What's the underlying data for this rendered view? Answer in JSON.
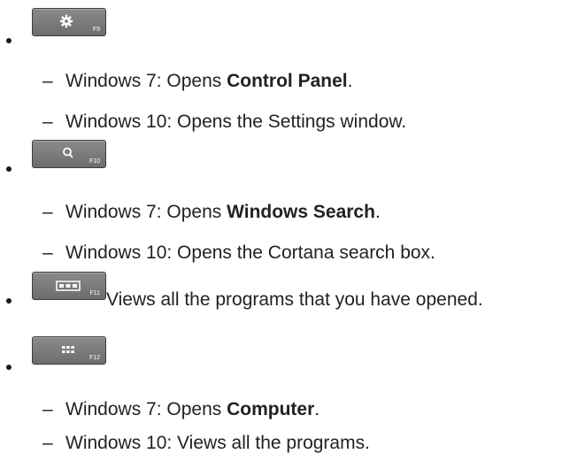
{
  "items": [
    {
      "key_label": "F9",
      "key_icon": "gear-icon",
      "subs": [
        {
          "dash": "–",
          "pre": "Windows 7: Opens ",
          "bold": "Control Panel",
          "post": "."
        },
        {
          "dash": "–",
          "pre": "Windows 10: Opens the Settings window.",
          "bold": "",
          "post": ""
        }
      ]
    },
    {
      "key_label": "F10",
      "key_icon": "search-icon",
      "subs": [
        {
          "dash": "–",
          "pre": "Windows 7: Opens ",
          "bold": "Windows Search",
          "post": "."
        },
        {
          "dash": "–",
          "pre": "Windows 10: Opens the Cortana search box.",
          "bold": "",
          "post": ""
        }
      ]
    },
    {
      "key_label": "F11",
      "key_icon": "task-view-icon",
      "inline_text": "Views all the programs that you have opened."
    },
    {
      "key_label": "F12",
      "key_icon": "app-grid-icon",
      "subs": [
        {
          "dash": "–",
          "pre": "Windows 7: Opens ",
          "bold": "Computer",
          "post": "."
        },
        {
          "dash": "–",
          "pre": "Windows 10: Views all the programs.",
          "bold": "",
          "post": ""
        }
      ]
    }
  ]
}
